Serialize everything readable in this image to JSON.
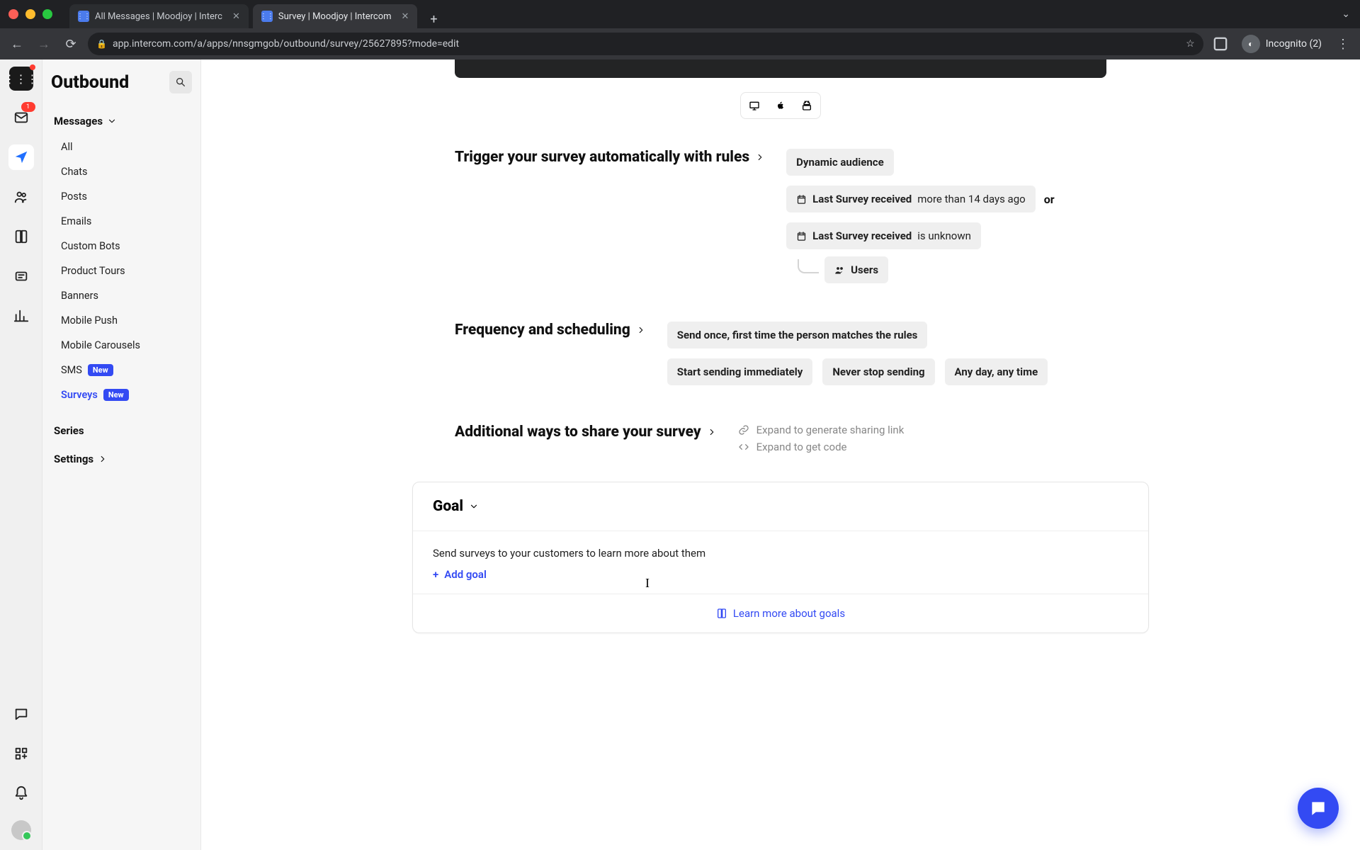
{
  "browser": {
    "tabs": [
      {
        "title": "All Messages | Moodjoy | Interc",
        "active": false
      },
      {
        "title": "Survey | Moodjoy | Intercom",
        "active": true
      }
    ],
    "url": "app.intercom.com/a/apps/nnsgmgob/outbound/survey/25627895?mode=edit",
    "incognito_label": "Incognito (2)"
  },
  "rail": {
    "inbox_badge": "1"
  },
  "sidebar": {
    "title": "Outbound",
    "messages_label": "Messages",
    "items": {
      "all": "All",
      "chats": "Chats",
      "posts": "Posts",
      "emails": "Emails",
      "custom_bots": "Custom Bots",
      "product_tours": "Product Tours",
      "banners": "Banners",
      "mobile_push": "Mobile Push",
      "mobile_carousels": "Mobile Carousels",
      "sms": "SMS",
      "sms_badge": "New",
      "surveys": "Surveys",
      "surveys_badge": "New"
    },
    "series_label": "Series",
    "settings_label": "Settings"
  },
  "main": {
    "trigger": {
      "heading": "Trigger your survey automatically with rules",
      "audience_chip": "Dynamic audience",
      "rule1_field": "Last Survey received",
      "rule1_cond": "more than 14 days ago",
      "or": "or",
      "rule2_field": "Last Survey received",
      "rule2_cond": "is unknown",
      "users_chip": "Users"
    },
    "frequency": {
      "heading": "Frequency and scheduling",
      "chip1": "Send once, first time the person matches the rules",
      "chip2": "Start sending immediately",
      "chip3": "Never stop sending",
      "chip4": "Any day, any time"
    },
    "share": {
      "heading": "Additional ways to share your survey",
      "link_text": "Expand to generate sharing link",
      "code_text": "Expand to get code"
    },
    "goal": {
      "heading": "Goal",
      "desc": "Send surveys to your customers to learn more about them",
      "add_goal": "Add goal",
      "learn_link": "Learn more about goals"
    }
  }
}
